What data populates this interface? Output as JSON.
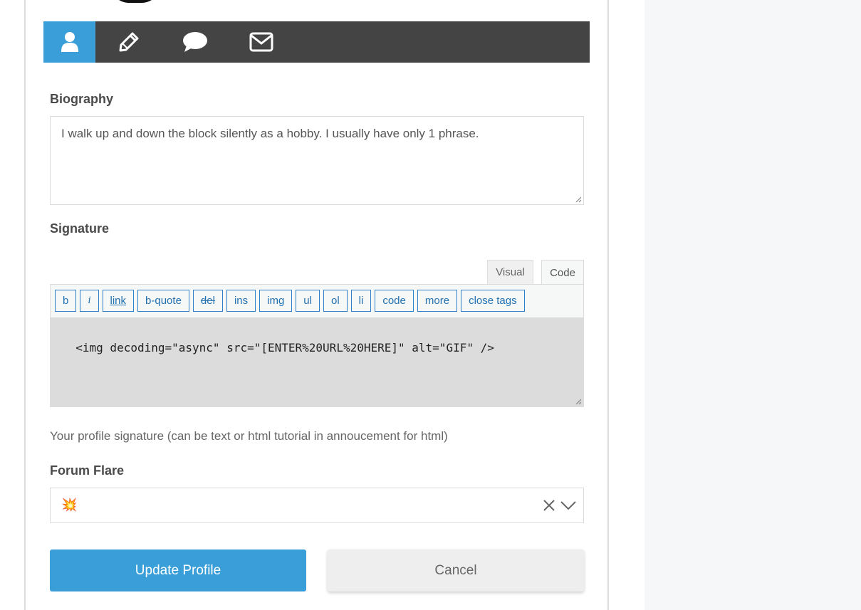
{
  "tabs": [
    {
      "icon": "user-icon",
      "active": true
    },
    {
      "icon": "pencil-icon",
      "active": false
    },
    {
      "icon": "speech-bubble-icon",
      "active": false
    },
    {
      "icon": "envelope-icon",
      "active": false
    }
  ],
  "biography": {
    "label": "Biography",
    "value": "I walk up and down the block silently as a hobby. I usually have only 1 phrase."
  },
  "signature": {
    "label": "Signature",
    "editor_tabs": {
      "visual": "Visual",
      "code": "Code"
    },
    "quicktags": [
      "b",
      "i",
      "link",
      "b-quote",
      "del",
      "ins",
      "img",
      "ul",
      "ol",
      "li",
      "code",
      "more",
      "close tags"
    ],
    "code_value": "<img decoding=\"async\" src=\"[ENTER%20URL%20HERE]\" alt=\"GIF\" />",
    "helper": "Your profile signature (can be text or html tutorial in annoucement for html)"
  },
  "forum_flare": {
    "label": "Forum Flare",
    "selected_value": "💥"
  },
  "buttons": {
    "update": "Update Profile",
    "cancel": "Cancel"
  },
  "colors": {
    "accent": "#3a9fd8",
    "tabbar": "#444444",
    "quicktag": "#2271b1"
  }
}
